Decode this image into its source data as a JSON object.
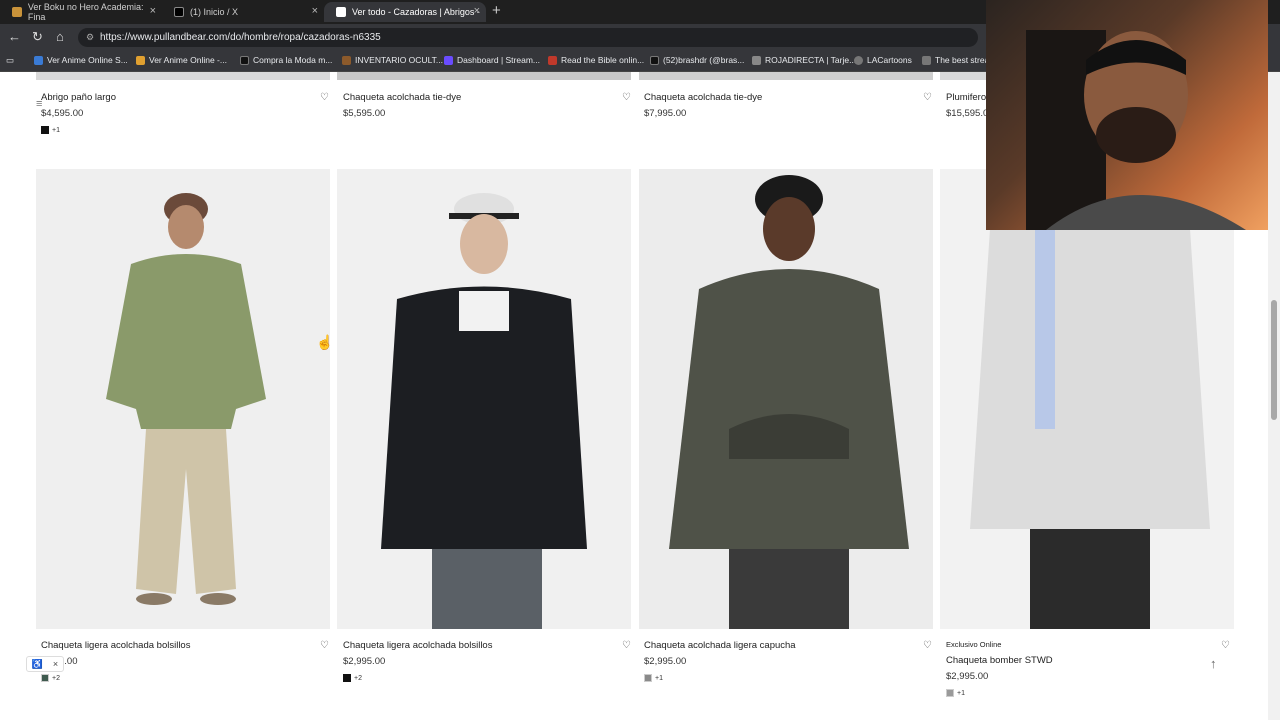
{
  "tabs": [
    {
      "title": "Ver Boku no Hero Academia: Fina",
      "color": "#c9933a"
    },
    {
      "title": "(1) Inicio / X",
      "color": "#000000"
    },
    {
      "title": "Ver todo - Cazadoras | Abrigos - ",
      "color": "#444444"
    }
  ],
  "address": {
    "url": "https://www.pullandbear.com/do/hombre/ropa/cazadoras-n6335"
  },
  "bookmarks": [
    {
      "label": "Ver Anime Online S...",
      "color": "#3a7bd5"
    },
    {
      "label": "Ver Anime Online -...",
      "color": "#e0a030"
    },
    {
      "label": "Compra la Moda m...",
      "color": "#111111"
    },
    {
      "label": "INVENTARIO OCULT...",
      "color": "#8c5a2b"
    },
    {
      "label": "Dashboard | Stream...",
      "color": "#6a4cff"
    },
    {
      "label": "Read the Bible onlin...",
      "color": "#c0392b"
    },
    {
      "label": "(52)brashdr (@bras...",
      "color": "#111111"
    },
    {
      "label": "ROJADIRECTA | Tarje...",
      "color": "#888888"
    },
    {
      "label": "LACartoons",
      "color": "#777777"
    },
    {
      "label": "The best strea",
      "color": "#777777"
    }
  ],
  "top_products": [
    {
      "name": "Abrigo paño largo",
      "price": "$4,595.00",
      "swatch": "#111111",
      "more": "+1"
    },
    {
      "name": "Chaqueta acolchada tie-dye",
      "price": "$5,595.00"
    },
    {
      "name": "Chaqueta acolchada tie-dye",
      "price": "$7,995.00"
    },
    {
      "name": "Plumifero",
      "price": "$15,595.0"
    }
  ],
  "products": [
    {
      "name": "Chaqueta ligera acolchada bolsillos",
      "price": "5.00",
      "swatch": "#3f5b4f",
      "more": "+2",
      "badge": ""
    },
    {
      "name": "Chaqueta ligera acolchada bolsillos",
      "price": "$2,995.00",
      "swatch": "#111111",
      "more": "+2",
      "badge": ""
    },
    {
      "name": "Chaqueta acolchada ligera capucha",
      "price": "$2,995.00",
      "swatch": "#8a8a8a",
      "more": "+1",
      "badge": ""
    },
    {
      "name": "Chaqueta bomber STWD",
      "price": "$2,995.00",
      "swatch": "#9a9a9a",
      "more": "+1",
      "badge": "Exclusivo Online"
    }
  ],
  "icons": {
    "heart": "heart-icon",
    "up": "arrow-up-icon",
    "accessibility": "accessibility-icon"
  }
}
